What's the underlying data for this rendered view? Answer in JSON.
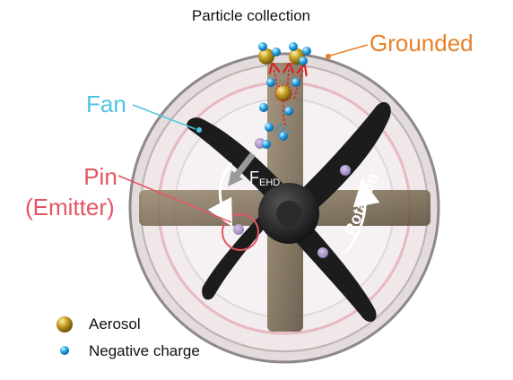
{
  "title": "Particle collection",
  "labels": {
    "grounded": "Grounded",
    "fan": "Fan",
    "pin": "Pin",
    "emitter": "(Emitter)",
    "force_main": "F",
    "force_sub": "EHD",
    "rotation": "Rotation"
  },
  "legend": {
    "aerosol": "Aerosol",
    "negative_charge": "Negative charge"
  },
  "colors": {
    "grounded": "#e8802a",
    "fan": "#4fc4e0",
    "pin": "#e45564",
    "aerosol": "#c9a227",
    "negative_charge": "#2aa8e8",
    "field_lines": "#e02020",
    "blade": "#1c1c1c",
    "strut": "#7a6a52",
    "housing": "#d9d2d2"
  },
  "icons": {
    "aerosol": "gold-sphere-icon",
    "negative_charge": "blue-sphere-icon",
    "force": "gray-arrow-icon",
    "rotation": "curved-arrow-icon"
  }
}
